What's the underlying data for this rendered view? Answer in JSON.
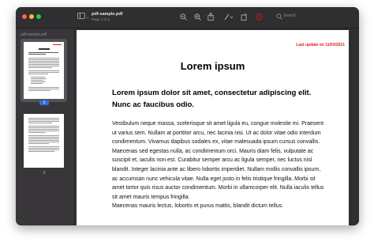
{
  "window": {
    "title": "pdf-sample.pdf",
    "subtitle": "Page 1 of 2",
    "search_placeholder": "Search"
  },
  "sidebar": {
    "label": "pdf-sample.pdf",
    "pages": [
      "1",
      "2"
    ],
    "selected_page": "1"
  },
  "document": {
    "last_update": "Last update on 11/03/2021",
    "heading": "Lorem ipsum",
    "subheading": "Lorem ipsum dolor sit amet, consectetur adipiscing elit. Nunc ac faucibus odio.",
    "paragraph1": "Vestibulum neque massa, scelerisque sit amet ligula eu, congue molestie mi. Praesent ut varius sem. Nullam at porttitor arcu, nec lacinia nisi. Ut ac dolor vitae odio interdum condimentum. Vivamus dapibus sodales ex, vitae malesuada ipsum cursus convallis. Maecenas sed egestas nulla, ac condimentum orci. Mauris diam felis, vulputate ac suscipit et, iaculis non est. Curabitur semper arcu ac ligula semper, nec luctus nisl blandit. Integer lacinia ante ac libero lobortis imperdiet. Nullam mollis convallis ipsum, ac accumsan nunc vehicula vitae. Nulla eget justo in felis tristique fringilla. Morbi sit amet tortor quis risus auctor condimentum. Morbi in ullamcorper elit. Nulla iaculis tellus sit amet mauris tempus fringilla.",
    "paragraph2": "Maecenas mauris lectus, lobortis et purus mattis, blandit dictum tellus."
  },
  "colors": {
    "accent": "#2f6fe0",
    "last_update": "#e0191f"
  },
  "icons": [
    "sidebar-toggle-icon",
    "chevron-down-icon",
    "zoom-out-icon",
    "zoom-in-icon",
    "share-icon",
    "markup-icon",
    "rotate-icon",
    "annotate-icon",
    "search-icon"
  ]
}
